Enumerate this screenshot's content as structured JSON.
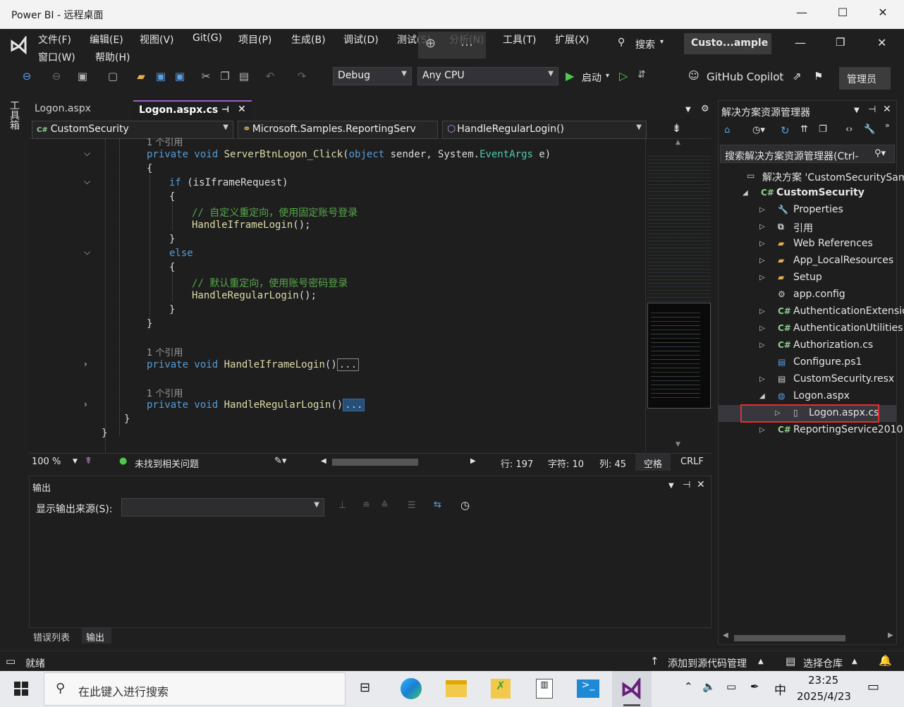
{
  "window": {
    "title": "Power BI - 远程桌面"
  },
  "menu": [
    "文件(F)",
    "编辑(E)",
    "视图(V)",
    "Git(G)",
    "项目(P)",
    "生成(B)",
    "调试(D)",
    "测试(S)",
    "分析(N)",
    "工具(T)",
    "扩展(X)"
  ],
  "menu2": [
    "窗口(W)",
    "帮助(H)"
  ],
  "search_label": "搜索",
  "solution_badge": "Custo...ample",
  "toolbar": {
    "config": "Debug",
    "platform": "Any CPU",
    "start_label": "启动",
    "copilot": "GitHub Copilot",
    "admin": "管理员"
  },
  "side_strip": "工具箱",
  "tabs": [
    {
      "label": "Logon.aspx"
    },
    {
      "label": "Logon.aspx.cs"
    }
  ],
  "nav": {
    "project": "CustomSecurity",
    "class": "Microsoft.Samples.ReportingServ",
    "member": "HandleRegularLogin()"
  },
  "code": {
    "ref_top": "1 个引用",
    "line1_mod": "private void",
    "line1_fn": "ServerBtnLogon_Click",
    "line1_p1": "object",
    "line1_p1n": " sender, ",
    "line1_p2a": "System.",
    "line1_p2b": "EventArgs",
    "line1_p2c": " e)",
    "brace_open": "{",
    "if_kw": "if",
    "if_cond": " (isIframeRequest)",
    "cm1": "// 自定义重定向，使用固定账号登录",
    "call1": "HandleIframeLogin",
    "call_suffix": "();",
    "brace_close": "}",
    "else_kw": "else",
    "cm2": "// 默认重定向，使用账号密码登录",
    "call2": "HandleRegularLogin",
    "ref1": "1 个引用",
    "fn2": "HandleIframeLogin",
    "ref2": "1 个引用",
    "fn3": "HandleRegularLogin",
    "collapsed": "...",
    "parens": "()"
  },
  "editor_status": {
    "zoom": "100 %",
    "issues": "未找到相关问题",
    "line": "行: 197",
    "char": "字符: 10",
    "col": "列: 45",
    "space": "空格",
    "crlf": "CRLF"
  },
  "output": {
    "title": "输出",
    "source_label": "显示输出来源(S):",
    "bottom_tabs": [
      "错误列表",
      "输出"
    ]
  },
  "solution_explorer": {
    "title": "解决方案资源管理器",
    "search_placeholder": "搜索解决方案资源管理器(Ctrl-",
    "items": [
      {
        "label": "解决方案 'CustomSecuritySam"
      },
      {
        "label": "CustomSecurity"
      },
      {
        "label": "Properties"
      },
      {
        "label": "引用"
      },
      {
        "label": "Web References"
      },
      {
        "label": "App_LocalResources"
      },
      {
        "label": "Setup"
      },
      {
        "label": "app.config"
      },
      {
        "label": "AuthenticationExtensic"
      },
      {
        "label": "AuthenticationUtilities."
      },
      {
        "label": "Authorization.cs"
      },
      {
        "label": "Configure.ps1"
      },
      {
        "label": "CustomSecurity.resx"
      },
      {
        "label": "Logon.aspx"
      },
      {
        "label": "Logon.aspx.cs"
      },
      {
        "label": "ReportingService2010."
      }
    ]
  },
  "statusbar": {
    "ready": "就绪",
    "add_source": "添加到源代码管理",
    "select_repo": "选择仓库"
  },
  "taskbar": {
    "search_placeholder": "在此键入进行搜索",
    "time": "23:25",
    "date": "2025/4/23",
    "ime": "中"
  },
  "colors": {
    "accent": "#68217a",
    "highlight": "#e03030"
  }
}
